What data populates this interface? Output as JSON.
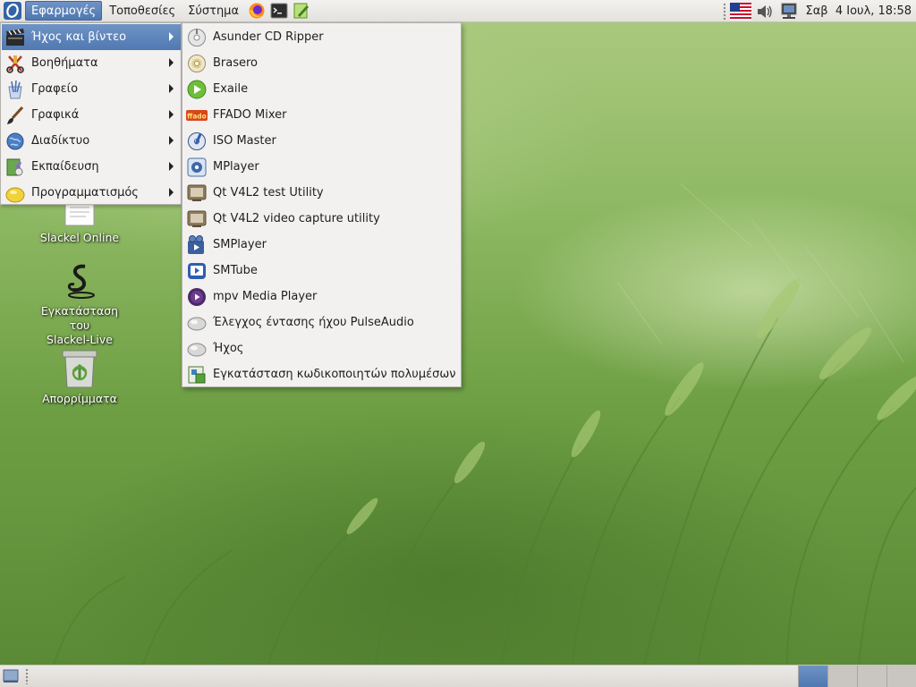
{
  "top_panel": {
    "menus": [
      "Εφαρμογές",
      "Τοποθεσίες",
      "Σύστημα"
    ],
    "active_menu_index": 0,
    "launchers": [
      "firefox-icon",
      "terminal-icon",
      "text-editor-icon"
    ],
    "tray_icons": [
      "us-flag-icon",
      "volume-icon",
      "network-icon"
    ],
    "clock": "Σαβ  4 Ιουλ, 18:58"
  },
  "applications_menu": {
    "categories": [
      {
        "label": "Ήχος και βίντεο",
        "icon": "multimedia-icon",
        "selected": true
      },
      {
        "label": "Βοηθήματα",
        "icon": "accessories-icon"
      },
      {
        "label": "Γραφείο",
        "icon": "office-icon"
      },
      {
        "label": "Γραφικά",
        "icon": "graphics-icon"
      },
      {
        "label": "Διαδίκτυο",
        "icon": "internet-icon"
      },
      {
        "label": "Εκπαίδευση",
        "icon": "education-icon"
      },
      {
        "label": "Προγραμματισμός",
        "icon": "programming-icon"
      }
    ]
  },
  "submenu": {
    "items": [
      {
        "label": "Asunder CD Ripper",
        "icon": "cd-ripper-icon"
      },
      {
        "label": "Brasero",
        "icon": "disc-burner-icon"
      },
      {
        "label": "Exaile",
        "icon": "exaile-play-icon"
      },
      {
        "label": "FFADO Mixer",
        "icon": "ffado-icon"
      },
      {
        "label": "ISO Master",
        "icon": "iso-master-icon"
      },
      {
        "label": "MPlayer",
        "icon": "mplayer-icon"
      },
      {
        "label": "Qt V4L2 test Utility",
        "icon": "tv-icon"
      },
      {
        "label": "Qt V4L2 video capture utility",
        "icon": "tv-icon"
      },
      {
        "label": "SMPlayer",
        "icon": "smplayer-icon"
      },
      {
        "label": "SMTube",
        "icon": "smtube-icon"
      },
      {
        "label": "mpv Media Player",
        "icon": "mpv-icon"
      },
      {
        "label": "Έλεγχος έντασης ήχου PulseAudio",
        "icon": "pulseaudio-icon"
      },
      {
        "label": "Ήχος",
        "icon": "sound-icon"
      },
      {
        "label": "Εγκατάσταση κωδικοποιητών πολυμέσων",
        "icon": "codec-installer-icon"
      }
    ]
  },
  "desktop": {
    "icons": [
      {
        "label": "Slackel Online",
        "icon": "document-icon"
      },
      {
        "label": "Εγκατάσταση του Slackel-Live",
        "label_line1": "Εγκατάσταση του",
        "label_line2": "Slackel-Live",
        "icon": "slackel-installer-icon"
      },
      {
        "label": "Απορρίμματα",
        "icon": "trash-icon"
      }
    ]
  },
  "bottom_panel": {
    "workspaces": 4,
    "active_workspace": 1
  }
}
